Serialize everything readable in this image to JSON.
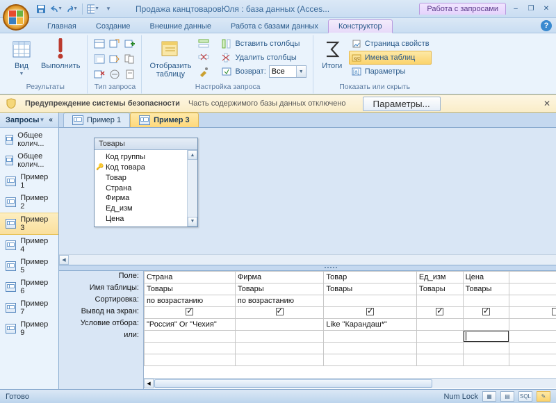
{
  "title": "Продажа канцтоваровЮля : база данных (Acces...",
  "context_tab": "Работа с запросами",
  "tabs": [
    "Главная",
    "Создание",
    "Внешние данные",
    "Работа с базами данных",
    "Конструктор"
  ],
  "active_tab": 4,
  "ribbon": {
    "groups": {
      "results": {
        "label": "Результаты",
        "view": "Вид",
        "run": "Выполнить"
      },
      "querytype": {
        "label": "Тип запроса"
      },
      "setup": {
        "label": "Настройка запроса",
        "show_table": "Отобразить\nтаблицу",
        "insert_cols": "Вставить столбцы",
        "delete_cols": "Удалить столбцы",
        "return_label": "Возврат:",
        "return_value": "Все"
      },
      "showhide": {
        "label": "Показать или скрыть",
        "totals": "Итоги",
        "prop_page": "Страница свойств",
        "table_names": "Имена таблиц",
        "parameters": "Параметры"
      }
    }
  },
  "security": {
    "title": "Предупреждение системы безопасности",
    "msg": "Часть содержимого базы данных отключено",
    "btn": "Параметры..."
  },
  "nav": {
    "header": "Запросы",
    "items": [
      "Общее колич...",
      "Общее колич...",
      "Пример 1",
      "Пример 2",
      "Пример 3",
      "Пример 4",
      "Пример 5",
      "Пример 6",
      "Пример 7",
      "Пример 9"
    ],
    "selected": 4
  },
  "doctabs": {
    "items": [
      "Пример 1",
      "Пример 3"
    ],
    "active": 1
  },
  "tablebox": {
    "title": "Товары",
    "fields": [
      "Код группы",
      "Код товара",
      "Товар",
      "Страна",
      "Фирма",
      "Ед_изм",
      "Цена"
    ],
    "key_index": 1
  },
  "grid": {
    "row_labels": [
      "Поле:",
      "Имя таблицы:",
      "Сортировка:",
      "Вывод на экран:",
      "Условие отбора:",
      "или:"
    ],
    "cols": [
      {
        "field": "Страна",
        "table": "Товары",
        "sort": "по возрастанию",
        "show": true,
        "crit": "\"Россия\" Or \"Чехия\"",
        "or": ""
      },
      {
        "field": "Фирма",
        "table": "Товары",
        "sort": "по возрастанию",
        "show": true,
        "crit": "",
        "or": ""
      },
      {
        "field": "Товар",
        "table": "Товары",
        "sort": "",
        "show": true,
        "crit": "Like \"Карандаш*\"",
        "or": ""
      },
      {
        "field": "Ед_изм",
        "table": "Товары",
        "sort": "",
        "show": true,
        "crit": "",
        "or": ""
      },
      {
        "field": "Цена",
        "table": "Товары",
        "sort": "",
        "show": true,
        "crit": "",
        "or": "",
        "cursor_or": true
      },
      {
        "field": "",
        "table": "",
        "sort": "",
        "show": false,
        "crit": "",
        "or": ""
      }
    ]
  },
  "status": {
    "left": "Готово",
    "numlock": "Num Lock"
  }
}
